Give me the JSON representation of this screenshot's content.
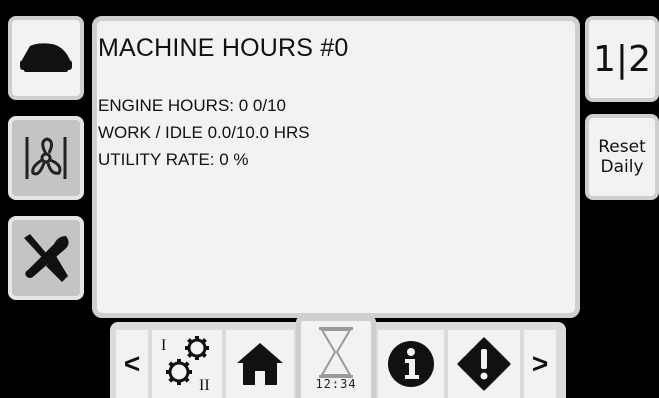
{
  "panel": {
    "title": "MACHINE HOURS #0",
    "lines": [
      "ENGINE HOURS:  0  0/10",
      "WORK / IDLE 0.0/10.0 HRS",
      "UTILITY RATE: 0 %"
    ]
  },
  "right": {
    "page_indicator": "1|2",
    "reset_label_line1": "Reset",
    "reset_label_line2": "Daily"
  },
  "bottom": {
    "prev_label": "<",
    "next_label": ">",
    "gear_mark_1": "I",
    "gear_mark_2": "II",
    "clock_text": "12:34"
  },
  "icons": {
    "left": [
      "machine-icon",
      "fan-icon",
      "tools-icon"
    ],
    "bottom": [
      "gears-icon",
      "home-icon",
      "hourglass-icon",
      "info-icon",
      "warning-icon"
    ]
  }
}
